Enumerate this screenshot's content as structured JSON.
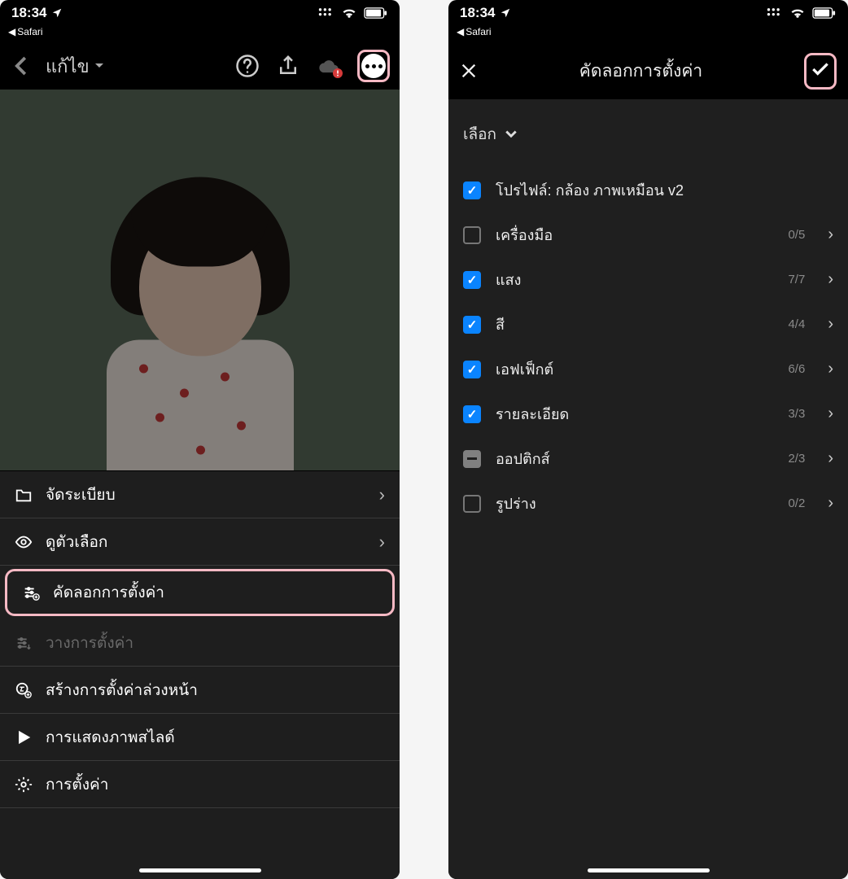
{
  "status": {
    "time": "18:34",
    "back_app": "Safari"
  },
  "left": {
    "nav_title": "แก้ไข",
    "menu": [
      {
        "label": "จัดระเบียบ",
        "icon": "folder-icon",
        "chevron": true,
        "disabled": false
      },
      {
        "label": "ดูตัวเลือก",
        "icon": "eye-icon",
        "chevron": true,
        "disabled": false
      },
      {
        "label": "คัดลอกการตั้งค่า",
        "icon": "sliders-plus-icon",
        "chevron": false,
        "disabled": false,
        "highlight": true
      },
      {
        "label": "วางการตั้งค่า",
        "icon": "sliders-down-icon",
        "chevron": false,
        "disabled": true
      },
      {
        "label": "สร้างการตั้งค่าล่วงหน้า",
        "icon": "formula-plus-icon",
        "chevron": false,
        "disabled": false
      },
      {
        "label": "การแสดงภาพสไลด์",
        "icon": "play-icon",
        "chevron": false,
        "disabled": false
      },
      {
        "label": "การตั้งค่า",
        "icon": "gear-icon",
        "chevron": false,
        "disabled": false
      }
    ]
  },
  "right": {
    "title": "คัดลอกการตั้งค่า",
    "select_label": "เลือก",
    "rows": [
      {
        "label": "โปรไฟล์: กล้อง ภาพเหมือน v2",
        "state": "checked",
        "count": "",
        "chevron": false
      },
      {
        "label": "เครื่องมือ",
        "state": "empty",
        "count": "0/5",
        "chevron": true
      },
      {
        "label": "แสง",
        "state": "checked",
        "count": "7/7",
        "chevron": true
      },
      {
        "label": "สี",
        "state": "checked",
        "count": "4/4",
        "chevron": true
      },
      {
        "label": "เอฟเฟ็กต์",
        "state": "checked",
        "count": "6/6",
        "chevron": true
      },
      {
        "label": "รายละเอียด",
        "state": "checked",
        "count": "3/3",
        "chevron": true
      },
      {
        "label": "ออปติกส์",
        "state": "partial",
        "count": "2/3",
        "chevron": true
      },
      {
        "label": "รูปร่าง",
        "state": "empty",
        "count": "0/2",
        "chevron": true
      }
    ]
  }
}
